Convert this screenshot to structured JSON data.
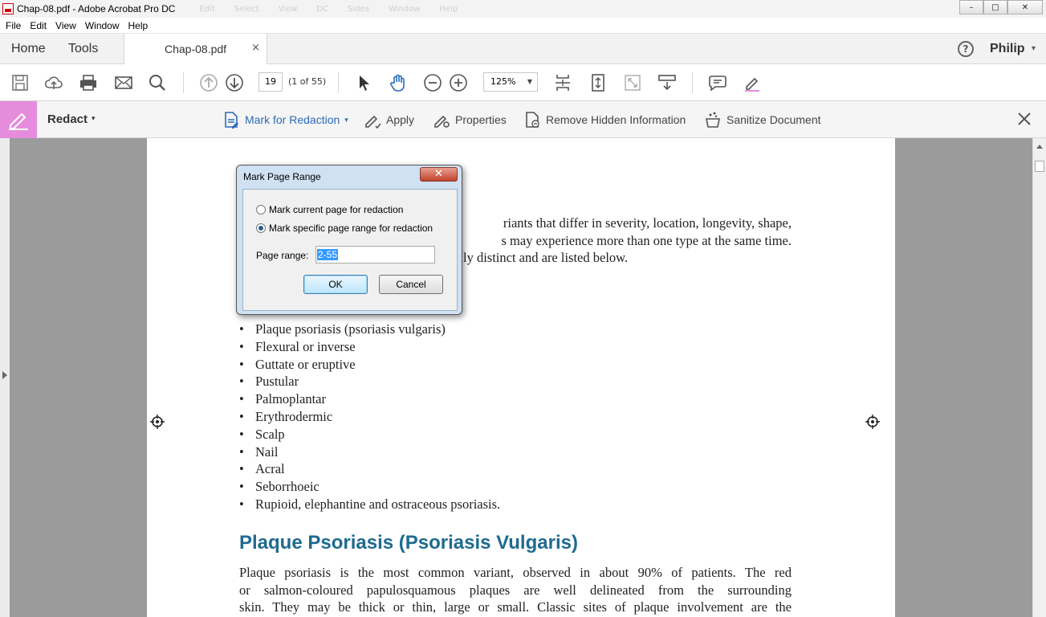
{
  "window": {
    "title": "Chap-08.pdf - Adobe Acrobat Pro DC",
    "ghost_menu": [
      "Edit",
      "Select",
      "View",
      "DC",
      "Sides",
      "Window",
      "Help"
    ],
    "controls": {
      "minimize": "–",
      "maximize": "□",
      "close": "✕"
    }
  },
  "menubar": {
    "items": [
      "File",
      "Edit",
      "View",
      "Window",
      "Help"
    ]
  },
  "tabbar": {
    "home": "Home",
    "tools": "Tools",
    "document_tab": "Chap-08.pdf",
    "document_close": "×",
    "help_glyph": "?",
    "user": "Philip",
    "user_caret": "▾"
  },
  "toolbar": {
    "page_number": "19",
    "page_of": "(1 of 55)",
    "zoom": "125%",
    "zoom_caret": "▼",
    "icons": [
      "save-icon",
      "upload-icon",
      "print-icon",
      "email-icon",
      "search-icon",
      "prev-page-icon",
      "next-page-icon",
      "select-pointer-icon",
      "hand-tool-icon",
      "zoom-out-icon",
      "zoom-in-icon",
      "fit-page-icon",
      "scroll-mode-icon",
      "full-screen-icon",
      "read-mode-icon",
      "comment-icon",
      "highlight-icon"
    ]
  },
  "redact": {
    "title": "Redact",
    "caret": "▾",
    "mark_for_redaction": "Mark for Redaction",
    "mark_caret": "▾",
    "apply": "Apply",
    "properties": "Properties",
    "remove_hidden": "Remove Hidden Information",
    "sanitize": "Sanitize Document",
    "accent_color": "#e58cdd",
    "link_color": "#2a6ab8"
  },
  "document": {
    "intro_lines": [
      "riants that differ in severity, location, longevity, shape,",
      "s may experience more than one type at the same time.",
      "ly distinct and are listed below."
    ],
    "bullets": [
      "Plaque psoriasis (psoriasis vulgaris)",
      "Flexural or inverse",
      "Guttate or eruptive",
      "Pustular",
      "Palmoplantar",
      "Erythrodermic",
      "Scalp",
      "Nail",
      "Acral",
      "Seborrhoeic",
      "Rupioid, elephantine and ostraceous psoriasis."
    ],
    "section_heading": "Plaque Psoriasis (Psoriasis Vulgaris)",
    "heading_color": "#1f6a8f",
    "body_lines": [
      "Plaque psoriasis is the most common variant, observed in about 90% of patients. The red",
      "or salmon-coloured papulosquamous plaques are well delineated from the surrounding",
      "skin. They may be thick or thin, large or small. Classic sites of plaque involvement are the"
    ]
  },
  "dialog": {
    "title": "Mark Page Range",
    "close": "✕",
    "option_current": "Mark current page for redaction",
    "option_range": "Mark specific page range for redaction",
    "selected_option": "range",
    "range_label": "Page range:",
    "range_value": "2-55",
    "ok": "OK",
    "cancel": "Cancel"
  }
}
